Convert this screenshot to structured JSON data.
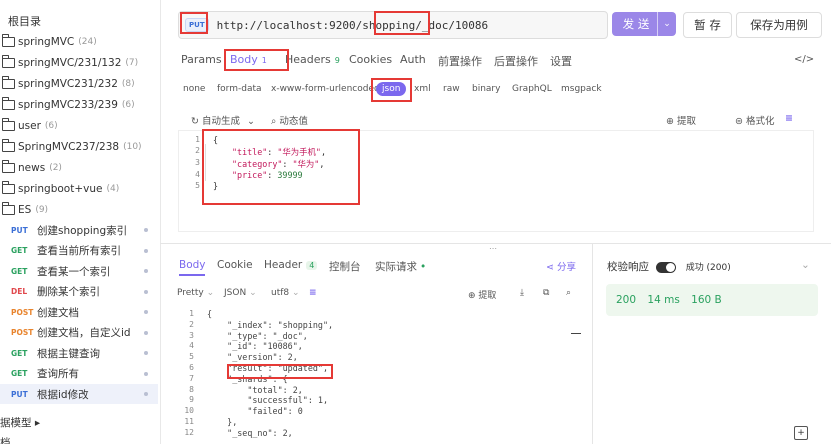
{
  "sidebar": {
    "root": "根目录",
    "folders": [
      {
        "name": "springMVC",
        "count": "(24)"
      },
      {
        "name": "springMVC/231/132",
        "count": "(7)"
      },
      {
        "name": "springMVC231/232",
        "count": "(8)"
      },
      {
        "name": "springMVC233/239",
        "count": "(6)"
      },
      {
        "name": "user",
        "count": "(6)"
      },
      {
        "name": "SpringMVC237/238",
        "count": "(10)"
      },
      {
        "name": "news",
        "count": "(2)"
      },
      {
        "name": "springboot+vue",
        "count": "(4)"
      },
      {
        "name": "ES",
        "count": "(9)"
      }
    ],
    "requests": [
      {
        "method": "PUT",
        "name": "创建shopping索引"
      },
      {
        "method": "GET",
        "name": "查看当前所有索引"
      },
      {
        "method": "GET",
        "name": "查看某一个索引"
      },
      {
        "method": "DEL",
        "name": "删除某个索引"
      },
      {
        "method": "POST",
        "name": "创建文档"
      },
      {
        "method": "POST",
        "name": "创建文档，自定义id"
      },
      {
        "method": "GET",
        "name": "根据主键查询"
      },
      {
        "method": "GET",
        "name": "查询所有"
      },
      {
        "method": "PUT",
        "name": "根据id修改"
      }
    ],
    "model": "据模型 ▸",
    "bottom": "档"
  },
  "request": {
    "method": "PUT",
    "url": "http://localhost:9200/shopping/_doc/10086",
    "send": "发 送",
    "send_arrow": "⌄",
    "save_draft": "暂 存",
    "save_case": "保存为用例"
  },
  "tabs": [
    {
      "label": "Params",
      "badge": ""
    },
    {
      "label": "Body",
      "badge": "1"
    },
    {
      "label": "Headers",
      "badge": "9"
    },
    {
      "label": "Cookies",
      "badge": ""
    },
    {
      "label": "Auth",
      "badge": ""
    },
    {
      "label": "前置操作",
      "badge": ""
    },
    {
      "label": "后置操作",
      "badge": ""
    },
    {
      "label": "设置",
      "badge": ""
    }
  ],
  "code_icon": "</>",
  "body_types": [
    "none",
    "form-data",
    "x-www-form-urlencoded",
    "json",
    "xml",
    "raw",
    "binary",
    "GraphQL",
    "msgpack"
  ],
  "body_tools": {
    "auto": "自动生成",
    "auto_arrow": "⌄",
    "dynamic": "动态值",
    "extract": "提取",
    "format": "格式化",
    "lines_icon": "≡"
  },
  "request_body": {
    "lines": [
      "1",
      "2",
      "3",
      "4",
      "5"
    ],
    "open": "{",
    "fields": [
      {
        "key": "\"title\"",
        "value": "\"华为手机\""
      },
      {
        "key": "\"category\"",
        "value": "\"华为\""
      },
      {
        "key": "\"price\"",
        "value": "39999"
      }
    ],
    "close": "}"
  },
  "response": {
    "tabs": [
      "Body",
      "Cookie",
      "Header",
      "控制台",
      "实际请求"
    ],
    "header_badge": "4",
    "share": "分享",
    "tools": {
      "pretty": "Pretty",
      "format": "JSON",
      "encoding": "utf8",
      "extract": "提取"
    },
    "validate_label": "校验响应",
    "validate_status": "成功 (200)",
    "status": "200",
    "time": "14 ms",
    "size": "160 B",
    "lines": [
      "1",
      "2",
      "3",
      "4",
      "5",
      "6",
      "7",
      "8",
      "9",
      "10",
      "11",
      "12"
    ],
    "code": [
      "{",
      "    \"_index\": \"shopping\",",
      "    \"_type\": \"_doc\",",
      "    \"_id\": \"10086\",",
      "    \"_version\": 2,",
      "    \"result\": \"updated\",",
      "    \"_shards\": {",
      "        \"total\": 2,",
      "        \"successful\": 1,",
      "        \"failed\": 0",
      "    },",
      "    \"_seq_no\": 2,"
    ]
  }
}
